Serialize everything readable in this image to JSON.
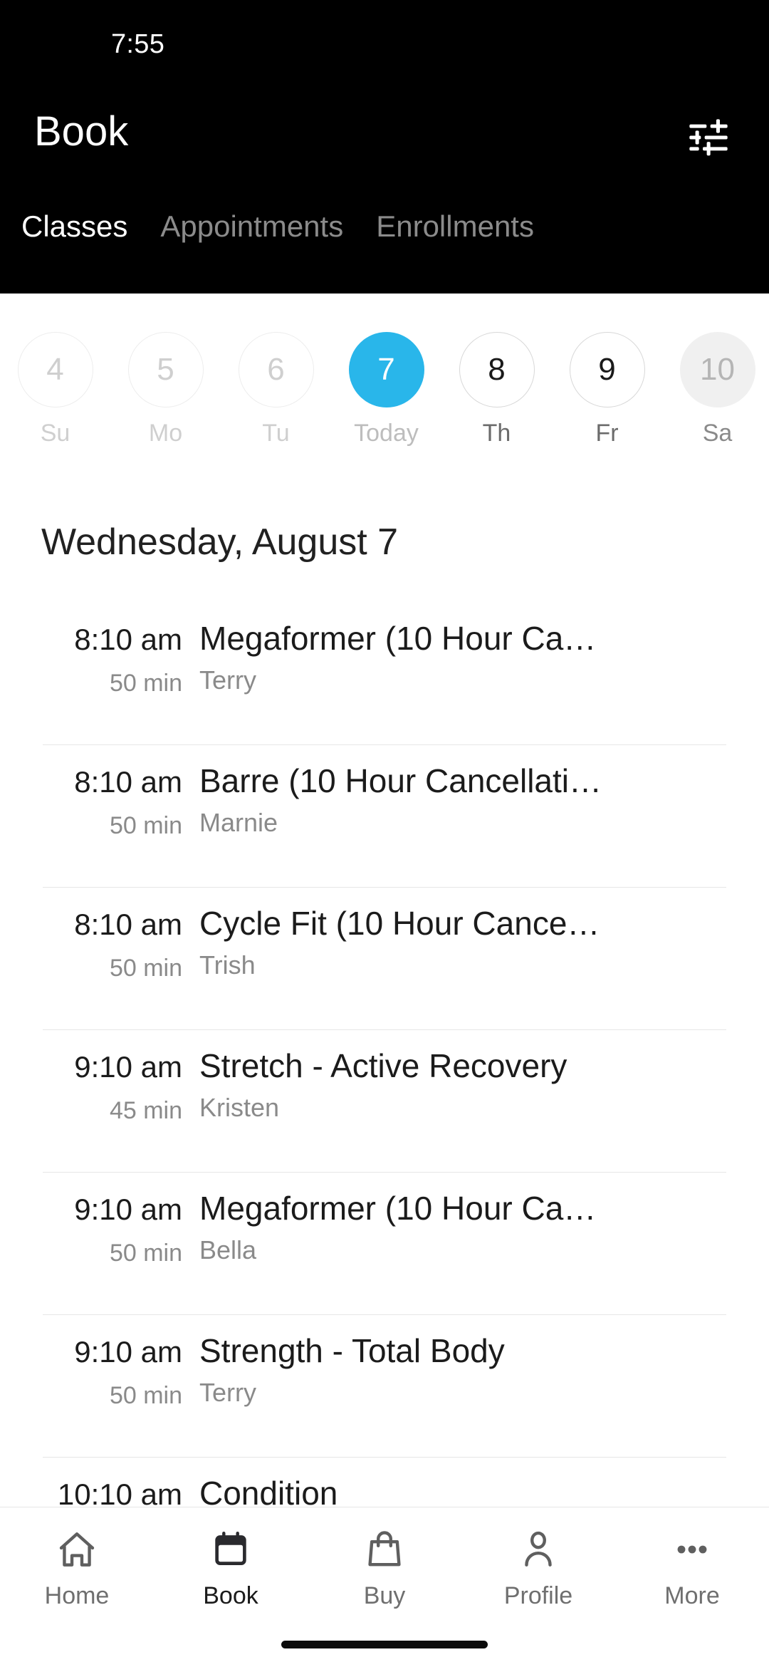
{
  "status_bar": {
    "time": "7:55"
  },
  "header": {
    "title": "Book",
    "filter_icon": "tune-filter-icon",
    "tabs": [
      {
        "label": "Classes",
        "active": true
      },
      {
        "label": "Appointments",
        "active": false
      },
      {
        "label": "Enrollments",
        "active": false
      }
    ]
  },
  "date_strip": {
    "days": [
      {
        "day_number": "4",
        "weekday": "Su",
        "state": "past"
      },
      {
        "day_number": "5",
        "weekday": "Mo",
        "state": "past"
      },
      {
        "day_number": "6",
        "weekday": "Tu",
        "state": "past"
      },
      {
        "day_number": "7",
        "weekday": "Today",
        "state": "today"
      },
      {
        "day_number": "8",
        "weekday": "Th",
        "state": "future"
      },
      {
        "day_number": "9",
        "weekday": "Fr",
        "state": "future"
      },
      {
        "day_number": "10",
        "weekday": "Sa",
        "state": "muted"
      }
    ]
  },
  "day_heading": "Wednesday, August 7",
  "classes": [
    {
      "time": "8:10 am",
      "duration": "50 min",
      "title": "Megaformer (10 Hour Ca…",
      "staff": "Terry"
    },
    {
      "time": "8:10 am",
      "duration": "50 min",
      "title": "Barre (10 Hour Cancellati…",
      "staff": "Marnie"
    },
    {
      "time": "8:10 am",
      "duration": "50 min",
      "title": "Cycle Fit (10 Hour Cance…",
      "staff": "Trish"
    },
    {
      "time": "9:10 am",
      "duration": "45 min",
      "title": "Stretch - Active Recovery",
      "staff": "Kristen"
    },
    {
      "time": "9:10 am",
      "duration": "50 min",
      "title": "Megaformer (10 Hour Ca…",
      "staff": "Bella"
    },
    {
      "time": "9:10 am",
      "duration": "50 min",
      "title": "Strength - Total Body",
      "staff": "Terry"
    },
    {
      "time": "10:10 am",
      "duration": "",
      "title": "Condition",
      "staff": ""
    }
  ],
  "bottom_nav": [
    {
      "label": "Home",
      "icon": "home-icon",
      "active": false
    },
    {
      "label": "Book",
      "icon": "calendar-icon",
      "active": true
    },
    {
      "label": "Buy",
      "icon": "bag-icon",
      "active": false
    },
    {
      "label": "Profile",
      "icon": "person-icon",
      "active": false
    },
    {
      "label": "More",
      "icon": "more-dots-icon",
      "active": false
    }
  ],
  "colors": {
    "header_bg": "#000000",
    "accent_blue": "#29b6ea",
    "active_tab_text": "#ffffff",
    "inactive_tab_text": "#8b8b8b",
    "primary_text": "#1b1b1b",
    "secondary_text": "#8a8a8a",
    "divider": "#e6e6e6"
  }
}
